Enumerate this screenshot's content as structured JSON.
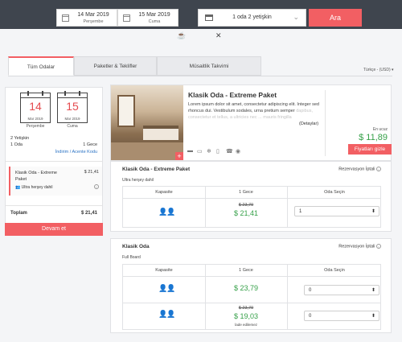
{
  "search": {
    "checkin_date": "14 Mar 2019",
    "checkin_day": "Perşembe",
    "checkout_date": "15 Mar 2019",
    "checkout_day": "Cuma",
    "rooms_guests": "1 oda 2 yetişkin",
    "search_label": "Ara"
  },
  "tabs": [
    {
      "label": "Tüm Odalar",
      "active": true
    },
    {
      "label": "Paketler & Teklifler",
      "active": false
    },
    {
      "label": "Müsaitlik Takvimi",
      "active": false
    }
  ],
  "language": "Türkçe - (USD) ▾",
  "summary": {
    "checkin": {
      "day_num": "14",
      "month_year": "Mar 2019",
      "weekday": "Perşembe"
    },
    "checkout": {
      "day_num": "15",
      "month_year": "Mar 2019",
      "weekday": "Cuma"
    },
    "adults": "2 Yetişkin",
    "rooms": "1 Oda",
    "nights": "1 Gece",
    "discount_link": "İndirim / Acente Kodu",
    "selected_room": "Klasik Oda - Extreme Paket",
    "selected_price": "$ 21,41",
    "selected_board": "Ultra herşey dahil",
    "total_label": "Toplam",
    "total_value": "$ 21,41",
    "continue_label": "Devam et"
  },
  "hotel": {
    "name": "Klasik Oda - Extreme Paket",
    "description": "Lorem ipsum dolor sit amet, consectetur adipiscing elit. Integer sed rhoncus dui. Vestibulum sodales, urna pretium semper",
    "description_faded": "dapibus, consectetur et tellus, a ultricies nec ... mauris fringilla",
    "details_link": "(Detaylar)",
    "from_label": "En ucuz",
    "from_price": "$ 11,89",
    "hide_prices": "Fiyatları gizle",
    "amenities": [
      "bed-icon",
      "tv-icon",
      "ac-icon",
      "minibar-icon",
      "phone-icon",
      "location-icon"
    ]
  },
  "rooms": [
    {
      "title": "Klasik Oda - Extreme Paket",
      "board": "Ultra herşey dahil",
      "cancel": "Rezervasyon İptali",
      "headers": [
        "Kapasite",
        "1 Gece",
        "Oda Seçin"
      ],
      "rows": [
        {
          "capacity": "2",
          "old_price": "$ 23,79",
          "price": "$ 21,41",
          "note": "",
          "selected": "1"
        }
      ]
    },
    {
      "title": "Klasik Oda",
      "board": "Full Board",
      "cancel": "Rezervasyon İptali",
      "headers": [
        "Kapasite",
        "1 Gece",
        "Oda Seçin"
      ],
      "rows": [
        {
          "capacity": "2",
          "old_price": "",
          "price": "$ 23,79",
          "note": "",
          "selected": "0"
        },
        {
          "capacity": "2",
          "old_price": "$ 23,79",
          "price": "$ 19,03",
          "note": "İade edilemez",
          "selected": "0"
        }
      ]
    }
  ]
}
